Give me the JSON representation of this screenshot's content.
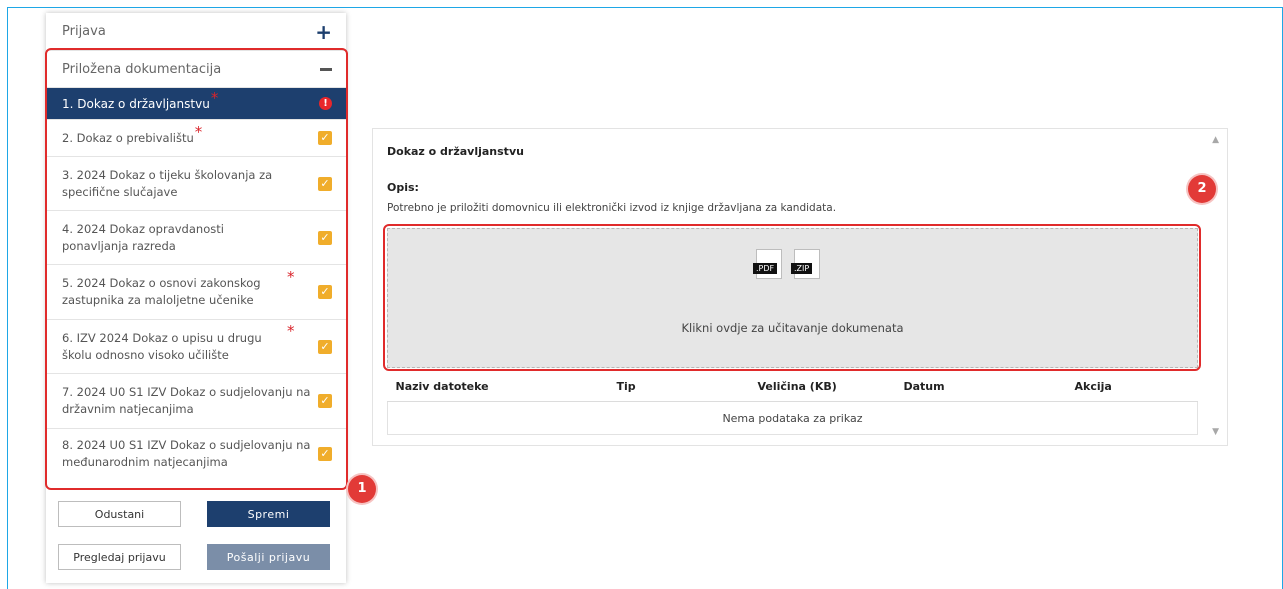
{
  "sidebar": {
    "sections": [
      {
        "label": "Prijava",
        "toggle": "+"
      },
      {
        "label": "Priložena dokumentacija",
        "toggle": "−"
      }
    ],
    "docs": [
      {
        "label": "1. Dokaz o državljanstvu",
        "required": true,
        "status": "error",
        "status_glyph": "!"
      },
      {
        "label": "2. Dokaz o prebivalištu",
        "required": true,
        "status": "done",
        "status_glyph": "✓"
      },
      {
        "label": "3. 2024 Dokaz o tijeku školovanja za specifične slučajave",
        "required": false,
        "status": "done",
        "status_glyph": "✓"
      },
      {
        "label": "4. 2024 Dokaz opravdanosti ponavljanja razreda",
        "required": false,
        "status": "done",
        "status_glyph": "✓"
      },
      {
        "label": "5. 2024 Dokaz o osnovi zakonskog zastupnika za maloljetne učenike",
        "required": true,
        "status": "done",
        "status_glyph": "✓"
      },
      {
        "label": "6. IZV 2024 Dokaz o upisu u drugu školu odnosno visoko učilište",
        "required": true,
        "status": "done",
        "status_glyph": "✓"
      },
      {
        "label": "7. 2024 U0 S1 IZV Dokaz o sudjelovanju na državnim natjecanjima",
        "required": false,
        "status": "done",
        "status_glyph": "✓"
      },
      {
        "label": "8. 2024 U0 S1 IZV Dokaz o sudjelovanju na međunarodnim natjecanjima",
        "required": false,
        "status": "done",
        "status_glyph": "✓"
      }
    ],
    "required_mark": "*",
    "buttons": {
      "cancel": "Odustani",
      "save": "Spremi",
      "preview": "Pregledaj prijavu",
      "submit": "Pošalji prijavu"
    }
  },
  "callouts": {
    "one": "1",
    "two": "2"
  },
  "panel": {
    "title": "Dokaz o državljanstvu",
    "opis_label": "Opis:",
    "description": "Potrebno je priložiti domovnicu ili elektronički izvod iz knjige državljana za kandidata.",
    "file_types": [
      ".PDF",
      ".ZIP"
    ],
    "upload_text": "Klikni ovdje za učitavanje dokumenata",
    "table": {
      "columns": [
        "Naziv datoteke",
        "Tip",
        "Veličina (KB)",
        "Datum",
        "Akcija"
      ],
      "empty_text": "Nema podataka za prikaz"
    }
  },
  "colors": {
    "navy": "#1d3f6e",
    "highlight": "#e02b2b",
    "check": "#f0ad2b",
    "frame": "#1ea7e6"
  }
}
